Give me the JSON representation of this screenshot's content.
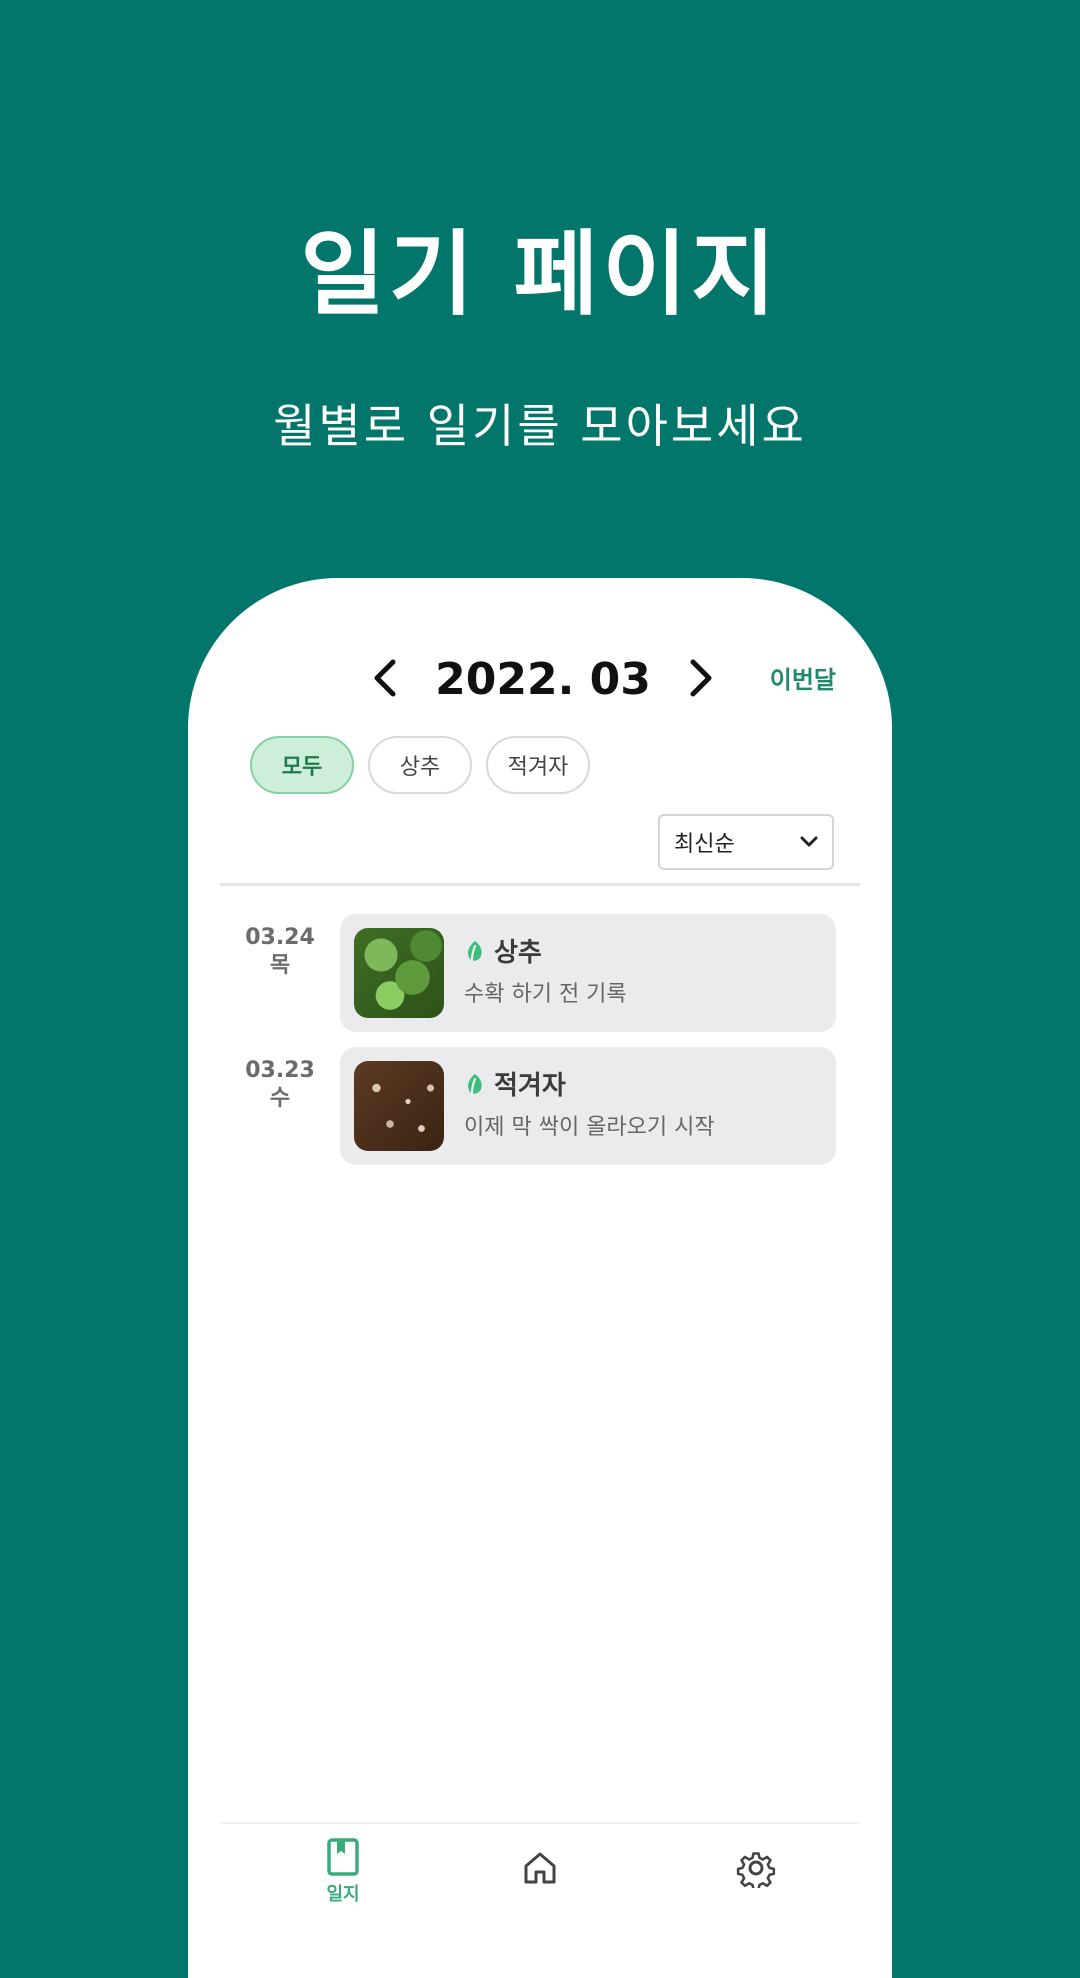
{
  "hero": {
    "title": "일기 페이지",
    "subtitle": "월별로 일기를 모아보세요"
  },
  "header": {
    "month": "2022. 03",
    "prev_icon": "chevron-left-icon",
    "next_icon": "chevron-right-icon",
    "this_month_label": "이번달"
  },
  "filters": {
    "chips": [
      {
        "label": "모두",
        "active": true
      },
      {
        "label": "상추",
        "active": false
      },
      {
        "label": "적겨자",
        "active": false
      }
    ]
  },
  "sort": {
    "selected": "최신순",
    "icon": "chevron-down-icon"
  },
  "entries": [
    {
      "date": "03.24",
      "weekday": "목",
      "plant": "상추",
      "description": "수확 하기 전 기록",
      "thumbnail": "lettuce-photo",
      "plant_icon": "leaf-icon"
    },
    {
      "date": "03.23",
      "weekday": "수",
      "plant": "적겨자",
      "description": "이제 막 싹이 올라오기 시작",
      "thumbnail": "soil-sprouts-photo",
      "plant_icon": "leaf-icon"
    }
  ],
  "bottom_nav": {
    "diary_label": "일지",
    "items": [
      "diary-icon",
      "home-icon",
      "settings-icon"
    ]
  },
  "colors": {
    "background": "#02766a",
    "accent": "#3cab7c",
    "chip_active_bg": "#cdeed9"
  }
}
